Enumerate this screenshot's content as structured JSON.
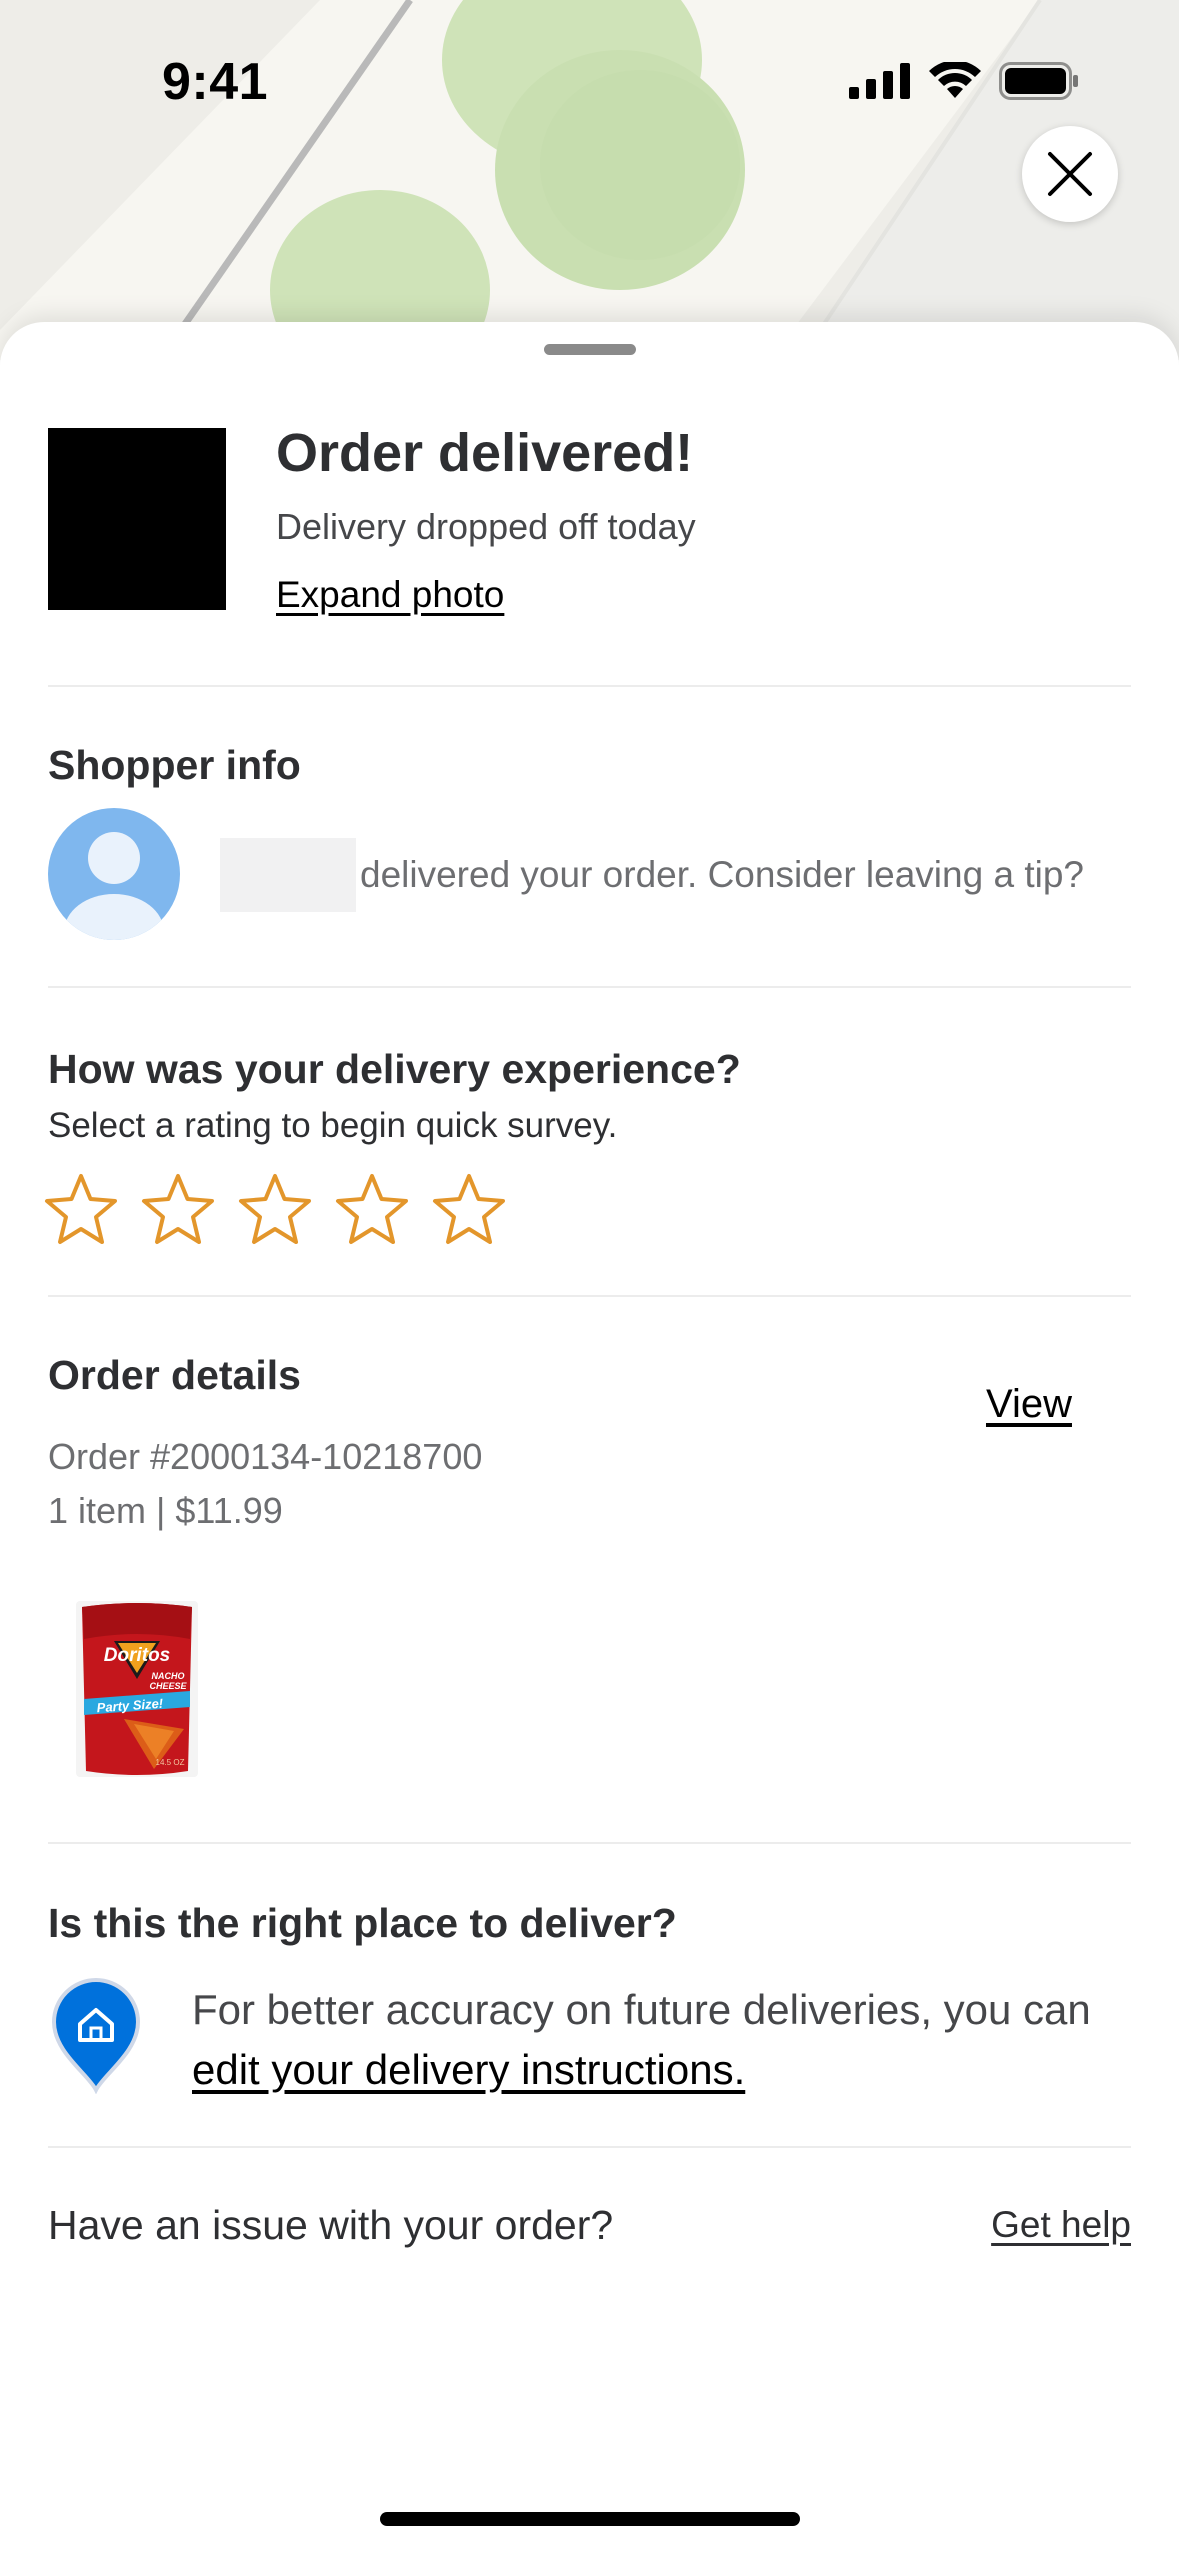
{
  "status_bar": {
    "time": "9:41"
  },
  "delivery": {
    "title": "Order delivered!",
    "subtitle": "Delivery dropped off today",
    "expand_photo": "Expand photo"
  },
  "shopper": {
    "section_title": "Shopper info",
    "message": "delivered your order. Consider leaving a tip?"
  },
  "survey": {
    "title": "How was your delivery experience?",
    "subtitle": "Select a rating to begin quick survey.",
    "rating_max": 5,
    "rating_value": 0,
    "star_color": "#e3962b"
  },
  "order": {
    "title": "Order details",
    "view_link": "View",
    "order_number": "Order #2000134-10218700",
    "summary": "1 item | $11.99",
    "items": [
      {
        "icon": "doritos-bag-image"
      }
    ]
  },
  "place": {
    "title": "Is this the right place to deliver?",
    "text_prefix": "For better accuracy on future deliveries, you can ",
    "link_text": "edit your delivery instructions."
  },
  "help": {
    "question": "Have an issue with your order?",
    "link": "Get help"
  },
  "colors": {
    "pin_blue": "#0071dc",
    "avatar_blue": "#7fb7ee"
  }
}
